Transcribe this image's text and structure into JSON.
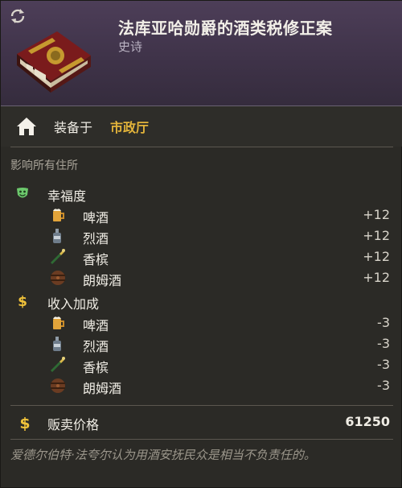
{
  "header": {
    "title": "法库亚哈勋爵的酒类税修正案",
    "rarity": "史诗"
  },
  "equip": {
    "label": "装备于",
    "value": "市政厅"
  },
  "scope": "影响所有住所",
  "happiness": {
    "label": "幸福度",
    "items": [
      {
        "label": "啤酒",
        "value": "+12",
        "icon": "beer-icon"
      },
      {
        "label": "烈酒",
        "value": "+12",
        "icon": "spirits-icon"
      },
      {
        "label": "香槟",
        "value": "+12",
        "icon": "champagne-icon"
      },
      {
        "label": "朗姆酒",
        "value": "+12",
        "icon": "rum-icon"
      }
    ]
  },
  "income": {
    "label": "收入加成",
    "items": [
      {
        "label": "啤酒",
        "value": "-3",
        "icon": "beer-icon"
      },
      {
        "label": "烈酒",
        "value": "-3",
        "icon": "spirits-icon"
      },
      {
        "label": "香槟",
        "value": "-3",
        "icon": "champagne-icon"
      },
      {
        "label": "朗姆酒",
        "value": "-3",
        "icon": "rum-icon"
      }
    ]
  },
  "sell": {
    "label": "贩卖价格",
    "value": "61250"
  },
  "flavor": "爱德尔伯特·法夸尔认为用酒安抚民众是相当不负责任的。",
  "colors": {
    "header_bg": "#4d3e58",
    "accent_gold": "#e3b43a",
    "happiness_green": "#6cc86c"
  }
}
